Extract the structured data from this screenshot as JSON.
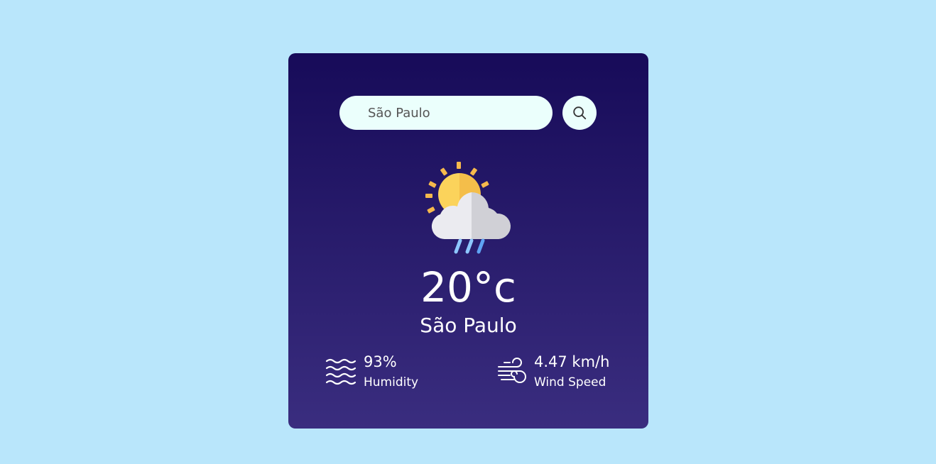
{
  "search": {
    "value": "São Paulo",
    "placeholder": "São Paulo",
    "button_icon": "search-icon"
  },
  "weather": {
    "icon": "sun-cloud-rain-icon",
    "temperature": "20°c",
    "city": "São Paulo"
  },
  "details": {
    "humidity": {
      "icon": "humidity-waves-icon",
      "value": "93%",
      "label": "Humidity"
    },
    "wind": {
      "icon": "wind-icon",
      "value": "4.47 km/h",
      "label": "Wind Speed"
    }
  },
  "colors": {
    "page_background": "#b9e6fb",
    "card_gradient_top": "#170b59",
    "card_gradient_bottom": "#3a2d7f",
    "input_background": "#ebfffc",
    "text": "#ffffff"
  }
}
